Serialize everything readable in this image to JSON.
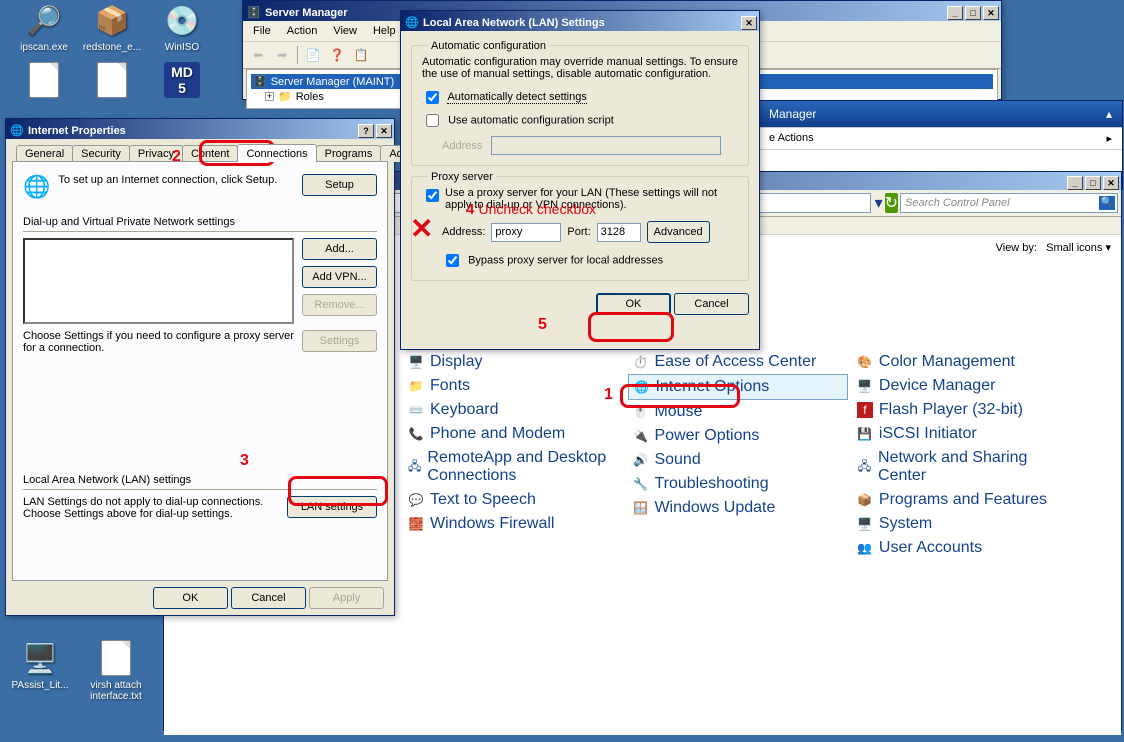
{
  "desktop": {
    "icons": [
      {
        "label": "ipscan.exe",
        "glyph": "🔍"
      },
      {
        "label": "redstone_e...",
        "glyph": "📦"
      },
      {
        "label": "WinISO",
        "glyph": "💿"
      },
      {
        "label": "",
        "glyph": "📄"
      },
      {
        "label": "",
        "glyph": "📄"
      },
      {
        "label": "",
        "glyph": "MD5"
      },
      {
        "label": "PAssist_Lit...",
        "glyph": "🖥️"
      },
      {
        "label": "virsh attach interface.txt",
        "glyph": "📄"
      }
    ]
  },
  "server_manager": {
    "title": "Server Manager",
    "menus": [
      "File",
      "Action",
      "View",
      "Help"
    ],
    "tree_root": "Server Manager (MAINT)",
    "tree_child": "Roles"
  },
  "internet_props": {
    "title": "Internet Properties",
    "tabs": [
      "General",
      "Security",
      "Privacy",
      "Content",
      "Connections",
      "Programs",
      "Advanced"
    ],
    "active_tab": "Connections",
    "setup_text": "To set up an Internet connection, click Setup.",
    "setup_btn": "Setup",
    "dialup_heading": "Dial-up and Virtual Private Network settings",
    "add_btn": "Add...",
    "addvpn_btn": "Add VPN...",
    "remove_btn": "Remove...",
    "settings_btn": "Settings",
    "chooseset": "Choose Settings if you need to configure a proxy server for a connection.",
    "lan_heading": "Local Area Network (LAN) settings",
    "lan_text": "LAN Settings do not apply to dial-up connections. Choose Settings above for dial-up settings.",
    "lan_btn": "LAN settings",
    "ok": "OK",
    "cancel": "Cancel",
    "apply": "Apply"
  },
  "lan_dlg": {
    "title": "Local Area Network (LAN) Settings",
    "autocfg_legend": "Automatic configuration",
    "autocfg_text": "Automatic configuration may override manual settings.  To ensure the use of manual settings, disable automatic configuration.",
    "auto_detect": "Automatically detect settings",
    "auto_script": "Use automatic configuration script",
    "address_lbl": "Address",
    "proxy_legend": "Proxy server",
    "proxy_text": "Use a proxy server for your LAN (These settings will not apply to dial-up or VPN connections).",
    "addr_lbl": "Address:",
    "port_lbl": "Port:",
    "addr_val": "proxy",
    "port_val": "3128",
    "advanced_btn": "Advanced",
    "bypass": "Bypass proxy server for local addresses",
    "ok": "OK",
    "cancel": "Cancel"
  },
  "control_panel": {
    "nav_header": "Manager",
    "more_actions": "e Actions",
    "search_placeholder": "Search Control Panel",
    "viewby_label": "View by:",
    "viewby_value": "Small icons",
    "items_col1": [
      "Display",
      "Fonts",
      "Keyboard",
      "Phone and Modem",
      "RemoteApp and Desktop Connections",
      "Text to Speech",
      "Windows Firewall"
    ],
    "items_col2": [
      "Ease of Access Center",
      "Internet Options",
      "Mouse",
      "Power Options",
      "Sound",
      "Troubleshooting",
      "Windows Update"
    ],
    "items_col3": [
      "Color Management",
      "Device Manager",
      "Flash Player (32-bit)",
      "iSCSI Initiator",
      "Network and Sharing Center",
      "Programs and Features",
      "System",
      "User Accounts"
    ]
  },
  "annotations": {
    "n1": "1",
    "n2": "2",
    "n3": "3",
    "n4": "4",
    "n5": "5",
    "uncheck": "Uncheck checkbox"
  }
}
